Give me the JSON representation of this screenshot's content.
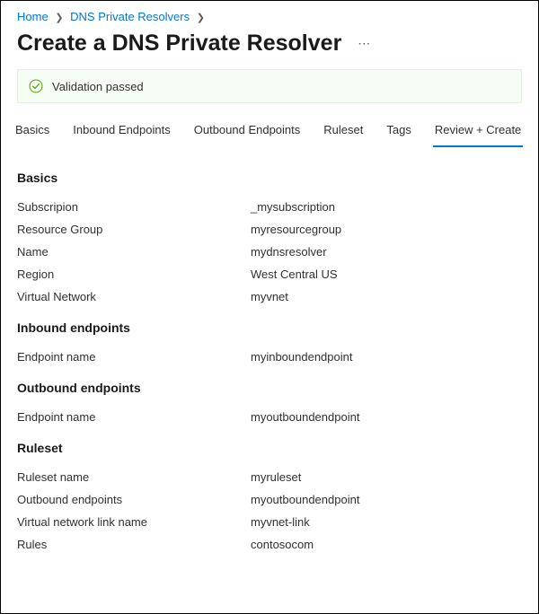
{
  "breadcrumb": {
    "home": "Home",
    "section": "DNS Private Resolvers"
  },
  "page": {
    "title": "Create a DNS Private Resolver"
  },
  "validation": {
    "message": "Validation passed"
  },
  "tabs": {
    "basics": "Basics",
    "inbound": "Inbound Endpoints",
    "outbound": "Outbound Endpoints",
    "ruleset": "Ruleset",
    "tags": "Tags",
    "review": "Review + Create"
  },
  "sections": {
    "basics": {
      "title": "Basics",
      "subscription_label": "Subscripion",
      "subscription_value": "_mysubscription",
      "rg_label": "Resource Group",
      "rg_value": "myresourcegroup",
      "name_label": "Name",
      "name_value": "mydnsresolver",
      "region_label": "Region",
      "region_value": "West Central US",
      "vnet_label": "Virtual Network",
      "vnet_value": "myvnet"
    },
    "inbound": {
      "title": "Inbound endpoints",
      "endpoint_label": "Endpoint name",
      "endpoint_value": "myinboundendpoint"
    },
    "outbound": {
      "title": "Outbound endpoints",
      "endpoint_label": "Endpoint name",
      "endpoint_value": "myoutboundendpoint"
    },
    "ruleset": {
      "title": "Ruleset",
      "ruleset_label": "Ruleset name",
      "ruleset_value": "myruleset",
      "outbound_label": "Outbound endpoints",
      "outbound_value": "myoutboundendpoint",
      "vnetlink_label": "Virtual network link name",
      "vnetlink_value": "myvnet-link",
      "rules_label": "Rules",
      "rules_value": "contosocom"
    }
  }
}
